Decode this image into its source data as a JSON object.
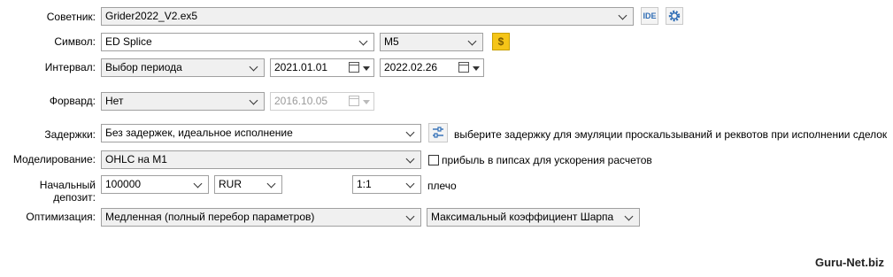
{
  "labels": {
    "advisor": "Советник:",
    "symbol": "Символ:",
    "interval": "Интервал:",
    "forward": "Форвард:",
    "delays": "Задержки:",
    "modeling": "Моделирование:",
    "deposit": "Начальный депозит:",
    "optimization": "Оптимизация:"
  },
  "advisor": {
    "value": "Grider2022_V2.ex5",
    "ide_label": "IDE"
  },
  "symbol": {
    "value": "ED Splice",
    "timeframe": "M5"
  },
  "interval": {
    "period": "Выбор периода",
    "from": "2021.01.01",
    "to": "2022.02.26"
  },
  "forward": {
    "value": "Нет",
    "date": "2016.10.05"
  },
  "delays": {
    "value": "Без задержек, идеальное исполнение",
    "hint": "выберите задержку для эмуляции проскальзываний и реквотов при исполнении сделок"
  },
  "modeling": {
    "value": "OHLC на M1",
    "pips_checkbox_label": "прибыль в пипсах для ускорения расчетов",
    "pips_checked": false
  },
  "deposit": {
    "amount": "100000",
    "currency": "RUR",
    "leverage": "1:1",
    "leverage_label": "плечо"
  },
  "optimization": {
    "method": "Медленная (полный перебор параметров)",
    "criterion": "Максимальный коэффициент Шарпа"
  },
  "watermark": "Guru-Net.biz",
  "colors": {
    "field_bg": "#f0f0f0",
    "border": "#a0a0a0",
    "icon_blue": "#2f6db5",
    "gold": "#f5c518"
  }
}
